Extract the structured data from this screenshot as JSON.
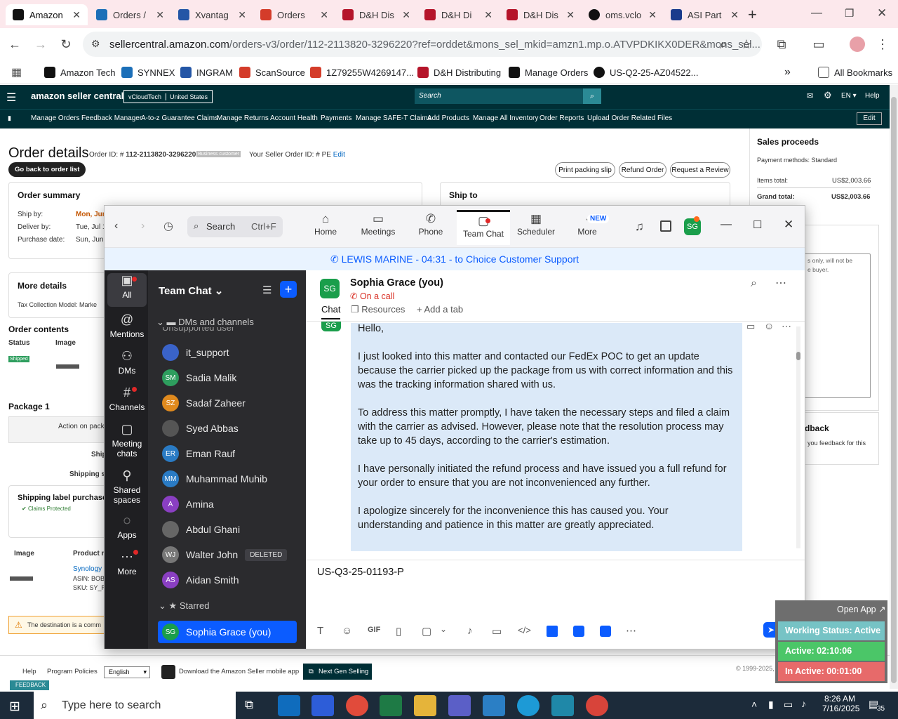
{
  "browser": {
    "tabs": [
      {
        "label": "Amazon",
        "active": true
      },
      {
        "label": "Orders / "
      },
      {
        "label": "Xvantag"
      },
      {
        "label": "Orders"
      },
      {
        "label": "D&H Dis"
      },
      {
        "label": "D&H Di"
      },
      {
        "label": "D&H Dis"
      },
      {
        "label": "oms.vclo"
      },
      {
        "label": "ASI Part"
      }
    ],
    "new_tab": "+",
    "url_host": "sellercentral.amazon.com",
    "url_path": "/orders-v3/order/112-2113820-3296220?ref=orddet&mons_sel_mkid=amzn1.mp.o.ATVPDKIKX0DER&mons_sel...",
    "bookmarks": [
      "Amazon Tech",
      "SYNNEX",
      "INGRAM",
      "ScanSource",
      "1Z79255W4269147...",
      "D&H Distributing",
      "Manage Orders",
      "US-Q2-25-AZ04522..."
    ],
    "all_bookmarks": "All Bookmarks"
  },
  "seller": {
    "logo": "amazon seller central",
    "account": "vCloudTech",
    "marketplace": "United States",
    "search_placeholder": "Search",
    "lang": "EN",
    "help": "Help",
    "nav": [
      "Manage Orders",
      "Feedback Manager",
      "A-to-z Guarantee Claims",
      "Manage Returns",
      "Account Health",
      "Payments",
      "Manage SAFE-T Claims",
      "Add Products",
      "Manage All Inventory",
      "Order Reports",
      "Upload Order Related Files"
    ],
    "edit": "Edit",
    "page_title": "Order details",
    "order_id_label": "Order ID: #",
    "order_id": "112-2113820-3296220",
    "business_badge": "Business customer",
    "seller_order_label": "Your Seller Order ID: # PE",
    "seller_order_edit": "Edit",
    "back_button": "Go back to order list",
    "buttons": [
      "Print packing slip",
      "Refund Order",
      "Request a Review"
    ],
    "order_summary": "Order summary",
    "ship_by_label": "Ship by:",
    "ship_by": "Mon, Jun",
    "deliver_by_label": "Deliver by:",
    "deliver_by": "Tue, Jul 1",
    "purchase_label": "Purchase date:",
    "purchase": "Sun, Jun",
    "ship_to": "Ship to",
    "more_details": "More details",
    "tax_model": "Tax Collection Model: Marke",
    "order_contents": "Order contents",
    "col_status": "Status",
    "col_image": "Image",
    "shipped": "Shipped",
    "package": "Package 1",
    "action_on_pack": "Action on pack",
    "ship_short": "Ship",
    "shipping_s": "Shipping s",
    "shipping_label": "Shipping label purchase",
    "claims_protected": "Claims Protected",
    "col_image2": "Image",
    "col_product": "Product n",
    "product_name": "Synology",
    "asin": "ASIN: BOB",
    "sku": "SKU: SY_R",
    "warning": "The destination is a comm",
    "sales_proceeds": "Sales proceeds",
    "payment_methods": "Payment methods: Standard",
    "items_total_label": "Items total:",
    "items_total": "US$2,003.66",
    "grand_total_label": "Grand total:",
    "grand_total": "US$2,003.66",
    "note_partial_1": "s only, will not be",
    "note_partial_2": "e buyer.",
    "feedback_partial": "dback",
    "feedback_text": "you feedback for this",
    "footer_help": "Help",
    "footer_policies": "Program Policies",
    "footer_lang": "English",
    "footer_app": "Download the Amazon Seller mobile app",
    "footer_ngs": "Next Gen Selling",
    "footer_copy": "© 1999-2025,",
    "feedback_tab": "FEEDBACK"
  },
  "zoom": {
    "search": "Search",
    "search_shortcut": "Ctrl+F",
    "tabs": [
      "Home",
      "Meetings",
      "Phone",
      "Team Chat",
      "Scheduler",
      "More"
    ],
    "more_badge": "NEW",
    "avatar": "SG",
    "banner": "LEWIS MARINE - 04:31 - to Choice Customer Support",
    "rail": [
      "All",
      "Mentions",
      "DMs",
      "Channels",
      "Meeting chats",
      "Shared spaces",
      "Apps",
      "More"
    ],
    "list_title": "Team Chat",
    "section": "DMs and channels",
    "cut_item": "Unsupported user",
    "contacts": [
      {
        "name": "it_support",
        "initials": "",
        "color": "#3a63c9"
      },
      {
        "name": "Sadia Malik",
        "initials": "SM",
        "color": "#2e9e5e"
      },
      {
        "name": "Sadaf Zaheer",
        "initials": "SZ",
        "color": "#e08a1e"
      },
      {
        "name": "Syed Abbas",
        "initials": "",
        "color": "#555"
      },
      {
        "name": "Eman Rauf",
        "initials": "ER",
        "color": "#2a7bc4"
      },
      {
        "name": "Muhammad Muhib",
        "initials": "MM",
        "color": "#2a7bc4"
      },
      {
        "name": "Amina",
        "initials": "A",
        "color": "#8a3fc2"
      },
      {
        "name": "Abdul Ghani",
        "initials": "",
        "color": "#666"
      },
      {
        "name": "Walter John",
        "initials": "WJ",
        "color": "#777"
      },
      {
        "name": "Aidan Smith",
        "initials": "AS",
        "color": "#8a3fc2"
      }
    ],
    "deleted": "DELETED",
    "starred": "Starred",
    "selected": "Sophia Grace (you)",
    "chat_name": "Sophia Grace (you)",
    "chat_status": "On a call",
    "chat_tabs": [
      "Chat",
      "Resources",
      "Add a tab"
    ],
    "message": [
      "Hello,",
      "I just looked into this matter and contacted our FedEx POC to get an update because the carrier picked up the package from us with correct information and this was the tracking information shared with us.",
      "To address this matter promptly, I have taken the necessary steps and filed a claim with the carrier as advised. However, please note that the resolution process may take up to 45 days, according to the carrier's estimation.",
      "I have personally initiated the refund process and have issued you a full refund for your order to ensure that you are not inconvenienced any further.",
      "I apologize sincerely for the inconvenience this has caused you. Your understanding and patience in this matter are greatly appreciated."
    ],
    "compose": "US-Q3-25-01193-P"
  },
  "status_widget": {
    "open_app": "Open App",
    "working": "Working Status: Active",
    "active": "Active: 02:10:06",
    "inactive": "In Active: 00:01:00"
  },
  "taskbar": {
    "search_placeholder": "Type here to search",
    "time": "8:26 AM",
    "date": "7/16/2025",
    "notifications": "35"
  }
}
